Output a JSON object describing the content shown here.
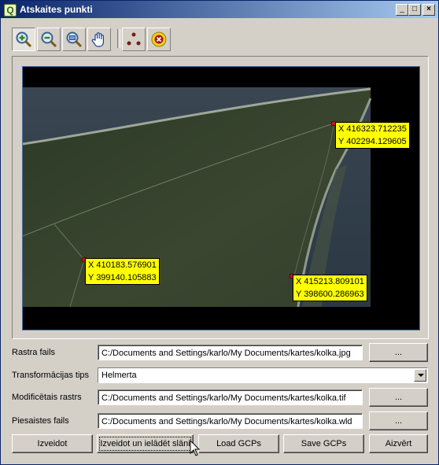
{
  "window": {
    "title": "Atskaites punkti",
    "app_icon_glyph": "Q",
    "controls": {
      "minimize": "_",
      "maximize": "□",
      "close": "×"
    }
  },
  "toolbar": {
    "icons": [
      "zoom-in-icon",
      "zoom-out-icon",
      "zoom-to-layer-icon",
      "pan-hand-icon",
      "add-point-icon",
      "delete-point-icon"
    ]
  },
  "gcps": [
    {
      "x": "X 416323.712235",
      "y": "Y 402294.129605"
    },
    {
      "x": "X 410183.576901",
      "y": "Y 399140.105883"
    },
    {
      "x": "X 415213.809101",
      "y": "Y 398600.286963"
    }
  ],
  "form": {
    "raster_label": "Rastra fails",
    "raster_value": "C:/Documents and Settings/karlo/My Documents/kartes/kolka.jpg",
    "transform_label": "Transformācijas tips",
    "transform_value": "Helmerta",
    "modified_label": "Modificētais rastrs",
    "modified_value": "C:/Documents and Settings/karlo/My Documents/kartes/kolka.tif",
    "world_label": "Piesaistes fails",
    "world_value": "C:/Documents and Settings/karlo/My Documents/kartes/kolka.wld",
    "browse_label": "..."
  },
  "buttons": {
    "create": "Izveidot",
    "create_load": "Izveidot un ielādēt slāni",
    "load_gcps": "Load GCPs",
    "save_gcps": "Save GCPs",
    "close": "Aizvērt"
  },
  "colors": {
    "title_start": "#0a246a",
    "title_end": "#a6caf0",
    "gcp_label_bg": "#ffff00",
    "gcp_marker": "#cc1111"
  }
}
